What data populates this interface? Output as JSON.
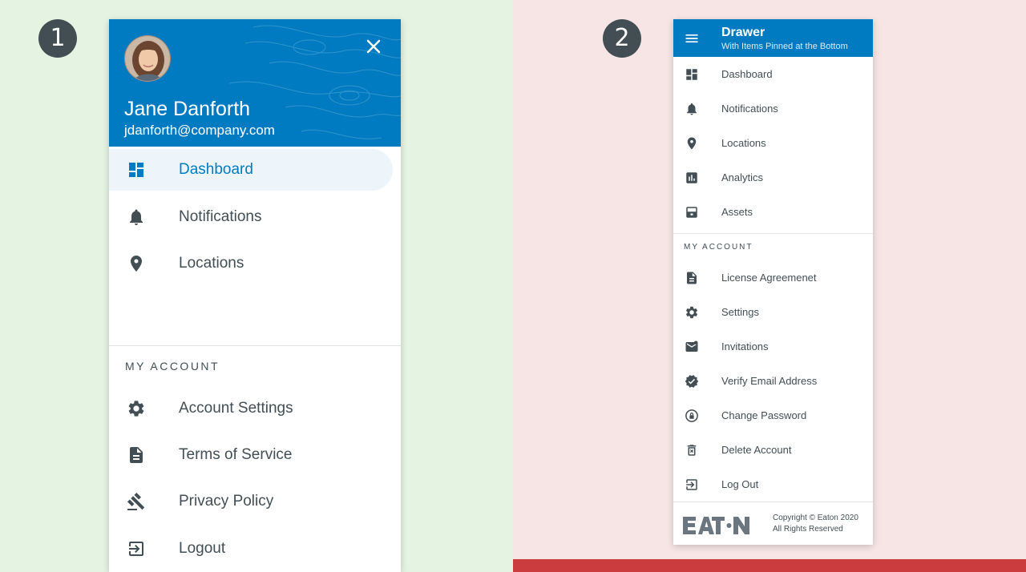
{
  "panel1": {
    "badge": "1",
    "user_name": "Jane Danforth",
    "user_email": "jdanforth@company.com",
    "nav": [
      {
        "label": "Dashboard",
        "icon": "dashboard-icon",
        "active": true
      },
      {
        "label": "Notifications",
        "icon": "bell-icon"
      },
      {
        "label": "Locations",
        "icon": "map-pin-icon"
      }
    ],
    "account_header": "MY ACCOUNT",
    "account": [
      {
        "label": "Account Settings",
        "icon": "gear-icon"
      },
      {
        "label": "Terms of Service",
        "icon": "document-icon"
      },
      {
        "label": "Privacy Policy",
        "icon": "gavel-icon"
      },
      {
        "label": "Logout",
        "icon": "logout-icon"
      }
    ]
  },
  "panel2": {
    "badge": "2",
    "title": "Drawer",
    "subtitle": "With Items Pinned at the Bottom",
    "nav": [
      {
        "label": "Dashboard",
        "icon": "dashboard-icon"
      },
      {
        "label": "Notifications",
        "icon": "bell-icon"
      },
      {
        "label": "Locations",
        "icon": "map-pin-icon"
      },
      {
        "label": "Analytics",
        "icon": "analytics-icon"
      },
      {
        "label": "Assets",
        "icon": "assets-icon"
      }
    ],
    "account_header": "MY ACCOUNT",
    "account": [
      {
        "label": "License Agreemenet",
        "icon": "document-icon"
      },
      {
        "label": "Settings",
        "icon": "gear-icon"
      },
      {
        "label": "Invitations",
        "icon": "mail-icon"
      },
      {
        "label": "Verify Email Address",
        "icon": "verified-icon"
      },
      {
        "label": "Change Password",
        "icon": "lock-icon"
      },
      {
        "label": "Delete Account",
        "icon": "trash-icon"
      },
      {
        "label": "Log Out",
        "icon": "logout-icon"
      }
    ],
    "footer": {
      "logo": "EATON",
      "copyright_line1": "Copyright © Eaton 2020",
      "copyright_line2": "All Rights Reserved"
    }
  },
  "colors": {
    "primary": "#007bc1",
    "text": "#424e54",
    "left_bg": "#e5f3e3",
    "right_bg": "#f7e5e5",
    "accent_bar": "#ca3c3d",
    "badge_bg": "#424e54"
  }
}
